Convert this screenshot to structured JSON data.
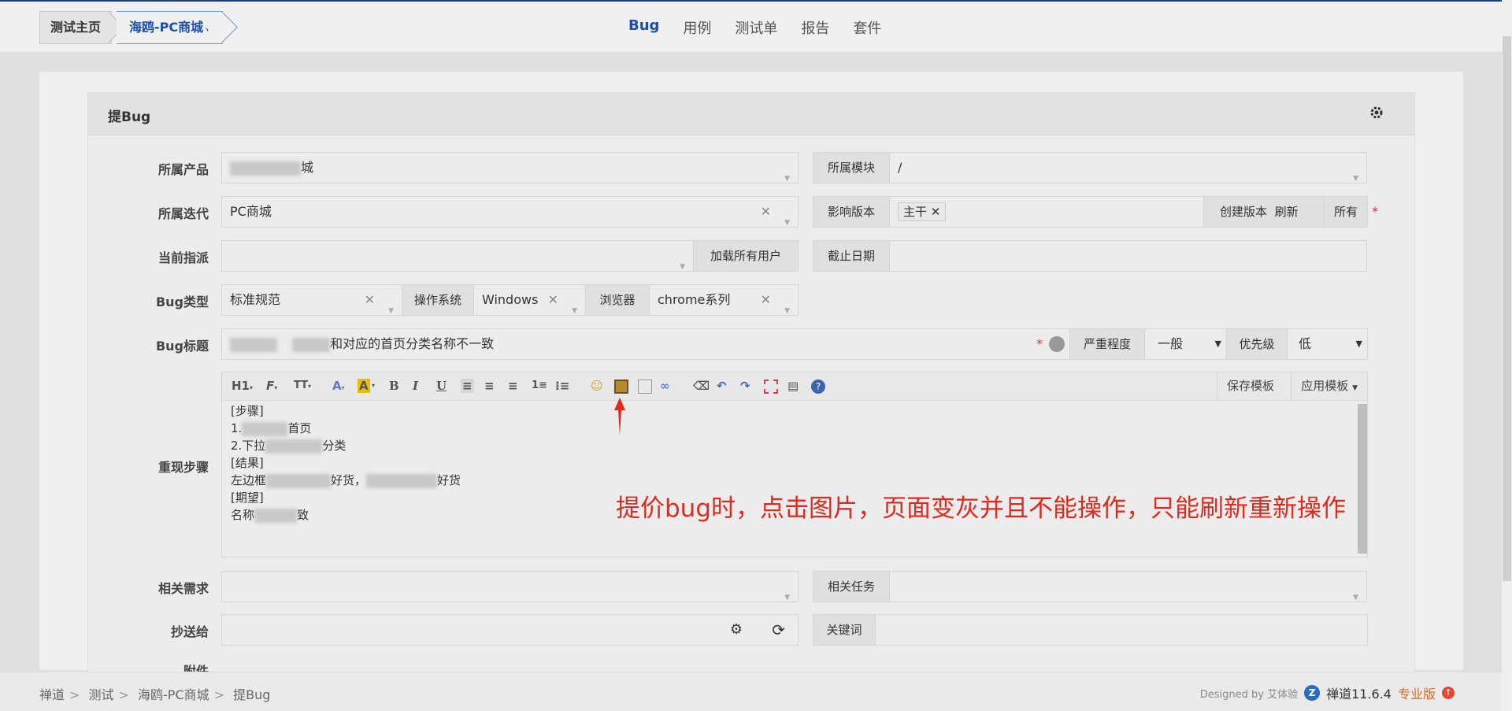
{
  "topbar": {
    "home_label": "测试主页",
    "product_label": "海鸥-PC商城",
    "nav": [
      "Bug",
      "用例",
      "测试单",
      "报告",
      "套件"
    ],
    "active_nav": "Bug"
  },
  "panel": {
    "title": "提Bug"
  },
  "form": {
    "product_label": "所属产品",
    "product_value": "城",
    "module_label": "所属模块",
    "module_value": "/",
    "iteration_label": "所属迭代",
    "iteration_value": "PC商城",
    "version_label": "影响版本",
    "version_tag": "主干",
    "create_version_btn": "创建版本",
    "refresh_btn": "刷新",
    "all_btn": "所有",
    "assign_label": "当前指派",
    "load_users_btn": "加载所有用户",
    "deadline_label": "截止日期",
    "bugtype_label": "Bug类型",
    "bugtype_value": "标准规范",
    "os_label": "操作系统",
    "os_value": "Windows",
    "browser_label": "浏览器",
    "browser_value": "chrome系列",
    "title_label": "Bug标题",
    "title_value": "和对应的首页分类名称不一致",
    "severity_label": "严重程度",
    "severity_value": "一般",
    "priority_label": "优先级",
    "priority_value": "低",
    "steps_label": "重现步骤",
    "related_req_label": "相关需求",
    "related_task_label": "相关任务",
    "cc_label": "抄送给",
    "keywords_label": "关键词",
    "attach_label": "附件"
  },
  "editor": {
    "save_template": "保存模板",
    "apply_template": "应用模板",
    "toolbar_h1": "H1",
    "toolbar_font": "F",
    "toolbar_size": "TT",
    "lines": {
      "l1": "[步骤]",
      "l2a": "1.",
      "l2b": "首页",
      "l3a": "2.下拉",
      "l3b": "分类",
      "l4": "[结果]",
      "l5a": "左边框",
      "l5b": "好货，",
      "l5c": "好货",
      "l6": "[期望]",
      "l7a": "名称",
      "l7b": "致"
    }
  },
  "annotation": "提价bug时，点击图片，页面变灰并且不能操作，只能刷新重新操作",
  "footer": {
    "crumbs": [
      "禅道",
      "测试",
      "海鸥-PC商城",
      "提Bug"
    ],
    "designed_by": "Designed by 艾体验",
    "brand": "禅道11.6.4",
    "edition": "专业版"
  },
  "colors": {
    "accent": "#1a4fae",
    "annotation": "#e02a1e",
    "required": "#e0302f"
  }
}
